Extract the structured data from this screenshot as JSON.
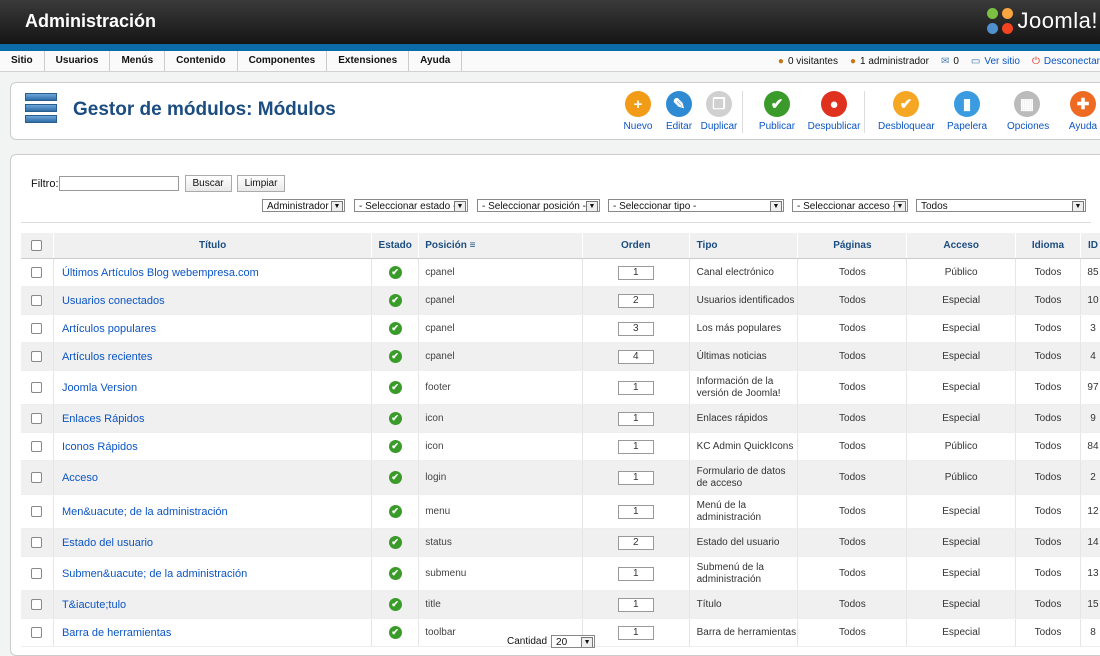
{
  "header": {
    "title": "Administración",
    "logo": "Joomla!"
  },
  "menu": [
    "Sitio",
    "Usuarios",
    "Menús",
    "Contenido",
    "Componentes",
    "Extensiones",
    "Ayuda"
  ],
  "status": {
    "visitors": "0 visitantes",
    "admins": "1 administrador",
    "messages": "0",
    "view_site": "Ver sitio",
    "logout": "Desconectar"
  },
  "page": {
    "title": "Gestor de módulos: Módulos"
  },
  "toolbar": [
    {
      "label": "Nuevo",
      "icon": "plus-icon",
      "color": "#f29b17",
      "glyph": "+"
    },
    {
      "label": "Editar",
      "icon": "edit-icon",
      "color": "#2f8ad4",
      "glyph": "✎"
    },
    {
      "label": "Duplicar",
      "icon": "copy-icon",
      "color": "#d0d0d0",
      "glyph": "❐"
    },
    {
      "label": "Publicar",
      "icon": "publish-icon",
      "color": "#3a9a2a",
      "glyph": "✔"
    },
    {
      "label": "Despublicar",
      "icon": "unpublish-icon",
      "color": "#e0301e",
      "glyph": "●"
    },
    {
      "label": "Desbloquear",
      "icon": "unlock-icon",
      "color": "#f5a623",
      "glyph": "✔"
    },
    {
      "label": "Papelera",
      "icon": "trash-icon",
      "color": "#3b9be0",
      "glyph": "▮"
    },
    {
      "label": "Opciones",
      "icon": "options-icon",
      "color": "#bbbbbb",
      "glyph": "▦"
    },
    {
      "label": "Ayuda",
      "icon": "help-icon",
      "color": "#ee6a22",
      "glyph": "✚"
    }
  ],
  "filter": {
    "label": "Filtro:",
    "value": "",
    "search_btn": "Buscar",
    "clear_btn": "Limpiar"
  },
  "selects": [
    "Administrador",
    "- Seleccionar estado -",
    "- Seleccionar posición -",
    "- Seleccionar tipo -",
    "- Seleccionar acceso -",
    "Todos"
  ],
  "columns": [
    "Título",
    "Estado",
    "Posición",
    "Orden",
    "Tipo",
    "Páginas",
    "Acceso",
    "Idioma",
    "ID"
  ],
  "rows": [
    {
      "title": "Últimos Artículos Blog webempresa.com",
      "pos": "cpanel",
      "order": "1",
      "tipo": "Canal electrónico",
      "pages": "Todos",
      "access": "Público",
      "lang": "Todos",
      "id": "85"
    },
    {
      "title": "Usuarios conectados",
      "pos": "cpanel",
      "order": "2",
      "tipo": "Usuarios identificados",
      "pages": "Todos",
      "access": "Especial",
      "lang": "Todos",
      "id": "10"
    },
    {
      "title": "Artículos populares",
      "pos": "cpanel",
      "order": "3",
      "tipo": "Los más populares",
      "pages": "Todos",
      "access": "Especial",
      "lang": "Todos",
      "id": "3"
    },
    {
      "title": "Artículos recientes",
      "pos": "cpanel",
      "order": "4",
      "tipo": "Últimas noticias",
      "pages": "Todos",
      "access": "Especial",
      "lang": "Todos",
      "id": "4"
    },
    {
      "title": "Joomla Version",
      "pos": "footer",
      "order": "1",
      "tipo": "Información de la versión de Joomla!",
      "pages": "Todos",
      "access": "Especial",
      "lang": "Todos",
      "id": "97"
    },
    {
      "title": "Enlaces Rápidos",
      "pos": "icon",
      "order": "1",
      "tipo": "Enlaces rápidos",
      "pages": "Todos",
      "access": "Especial",
      "lang": "Todos",
      "id": "9"
    },
    {
      "title": "Iconos Rápidos",
      "pos": "icon",
      "order": "1",
      "tipo": "KC Admin QuickIcons",
      "pages": "Todos",
      "access": "Público",
      "lang": "Todos",
      "id": "84"
    },
    {
      "title": "Acceso",
      "pos": "login",
      "order": "1",
      "tipo": "Formulario de datos de acceso",
      "pages": "Todos",
      "access": "Público",
      "lang": "Todos",
      "id": "2"
    },
    {
      "title": "Men&uacute; de la administración",
      "pos": "menu",
      "order": "1",
      "tipo": "Menú de la administración",
      "pages": "Todos",
      "access": "Especial",
      "lang": "Todos",
      "id": "12"
    },
    {
      "title": "Estado del usuario",
      "pos": "status",
      "order": "2",
      "tipo": "Estado del usuario",
      "pages": "Todos",
      "access": "Especial",
      "lang": "Todos",
      "id": "14"
    },
    {
      "title": "Submen&uacute; de la administración",
      "pos": "submenu",
      "order": "1",
      "tipo": "Submenú de la administración",
      "pages": "Todos",
      "access": "Especial",
      "lang": "Todos",
      "id": "13"
    },
    {
      "title": "T&iacute;tulo",
      "pos": "title",
      "order": "1",
      "tipo": "Título",
      "pages": "Todos",
      "access": "Especial",
      "lang": "Todos",
      "id": "15"
    },
    {
      "title": "Barra de herramientas",
      "pos": "toolbar",
      "order": "1",
      "tipo": "Barra de herramientas",
      "pages": "Todos",
      "access": "Especial",
      "lang": "Todos",
      "id": "8"
    }
  ],
  "footer": {
    "label": "Cantidad",
    "value": "20"
  }
}
